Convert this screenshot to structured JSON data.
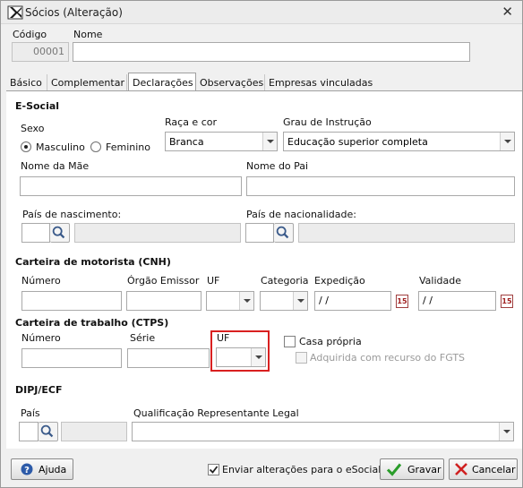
{
  "window": {
    "title": "Sócios (Alteração)"
  },
  "header": {
    "codigo_label": "Código",
    "codigo_value": "00001",
    "nome_label": "Nome",
    "nome_value": ""
  },
  "tabs": [
    {
      "label": "Básico",
      "active": false
    },
    {
      "label": "Complementar",
      "active": false
    },
    {
      "label": "Declarações",
      "active": true
    },
    {
      "label": "Observações",
      "active": false
    },
    {
      "label": "Empresas vinculadas",
      "active": false
    }
  ],
  "esocial": {
    "section_title": "E-Social",
    "sexo_label": "Sexo",
    "sexo_options": [
      "Masculino",
      "Feminino"
    ],
    "sexo_selected": "Masculino",
    "raca_label": "Raça e cor",
    "raca_value": "Branca",
    "grau_label": "Grau de Instrução",
    "grau_value": "Educação superior completa",
    "nome_mae_label": "Nome da Mãe",
    "nome_pai_label": "Nome do Pai",
    "pais_nascimento_label": "País de nascimento:",
    "pais_nacionalidade_label": "País de nacionalidade:"
  },
  "cnh": {
    "section_title": "Carteira de motorista (CNH)",
    "numero_label": "Número",
    "orgao_label": "Órgão Emissor",
    "uf_label": "UF",
    "categoria_label": "Categoria",
    "expedicao_label": "Expedição",
    "expedicao_value": " / /",
    "validade_label": "Validade",
    "validade_value": " / /",
    "calendar_glyph": "15"
  },
  "ctps": {
    "section_title": "Carteira de trabalho (CTPS)",
    "numero_label": "Número",
    "serie_label": "Série",
    "uf_label": "UF",
    "casa_propria_label": "Casa própria",
    "fgts_label": "Adquirida com recurso do FGTS"
  },
  "dipj": {
    "section_title": "DIPJ/ECF",
    "pais_label": "País",
    "qualificacao_label": "Qualificação Representante Legal"
  },
  "footer": {
    "ajuda_label": "Ajuda",
    "enviar_label": "Enviar alterações para o eSocial",
    "enviar_checked": true,
    "gravar_label": "Gravar",
    "cancelar_label": "Cancelar"
  },
  "colors": {
    "highlight": "#d92020",
    "confirm": "#2a9d2a",
    "cancel": "#d02020",
    "help": "#2c5aa8"
  }
}
